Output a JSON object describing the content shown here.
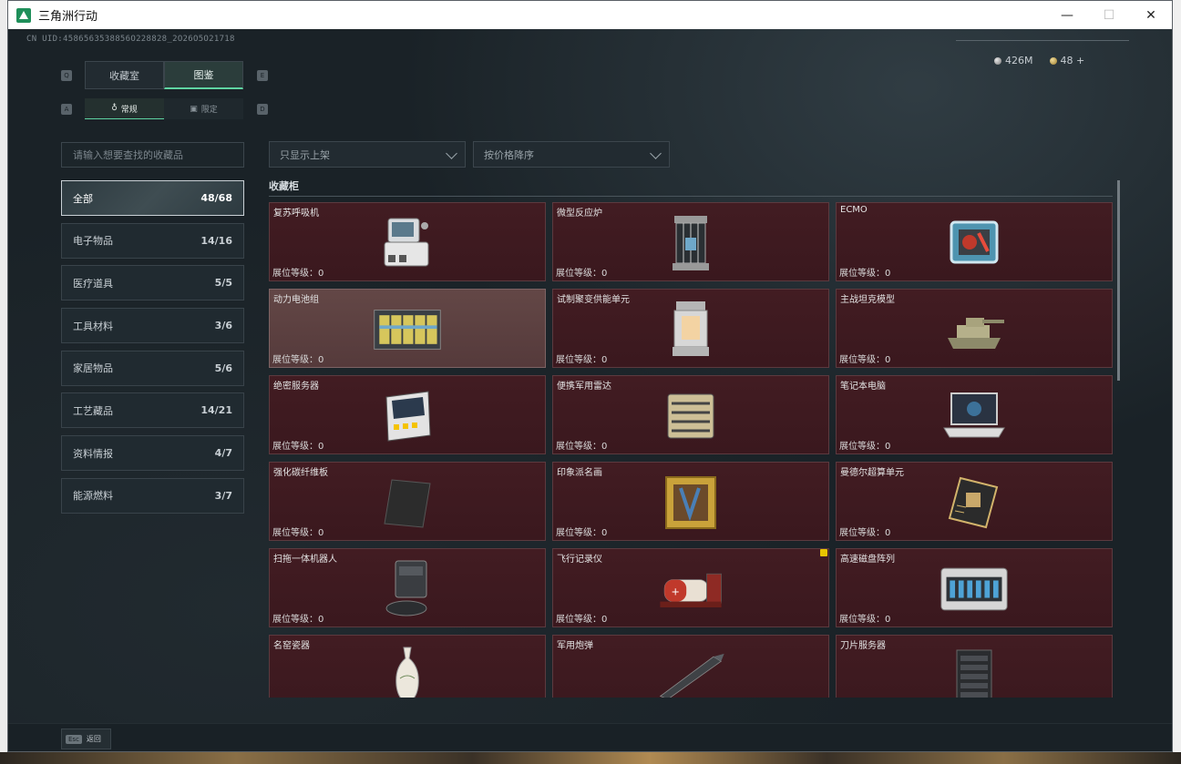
{
  "window": {
    "title": "三角洲行动",
    "minimize": "—",
    "maximize": "☐",
    "close": "✕"
  },
  "header": {
    "uid": "CN UID:4586563538856O228828_2O26O5O21718",
    "currency_silver": "426M",
    "currency_gold": "48 +"
  },
  "keys": {
    "q": "Q",
    "e": "E",
    "a": "A",
    "d": "D"
  },
  "tabs": [
    {
      "label": "收藏室",
      "active": false
    },
    {
      "label": "图鉴",
      "active": true
    }
  ],
  "subtabs": [
    {
      "label": "常规",
      "active": true
    },
    {
      "label": "限定",
      "active": false
    }
  ],
  "search": {
    "placeholder": "请输入想要查找的收藏品"
  },
  "filters": {
    "shelf": "只显示上架",
    "sort": "按价格降序"
  },
  "categories": [
    {
      "label": "全部",
      "count": "48/68",
      "active": true
    },
    {
      "label": "电子物品",
      "count": "14/16"
    },
    {
      "label": "医疗道具",
      "count": "5/5"
    },
    {
      "label": "工具材料",
      "count": "3/6"
    },
    {
      "label": "家居物品",
      "count": "5/6"
    },
    {
      "label": "工艺藏品",
      "count": "14/21"
    },
    {
      "label": "资料情报",
      "count": "4/7"
    },
    {
      "label": "能源燃料",
      "count": "3/7"
    }
  ],
  "section_title": "收藏柜",
  "level_label": "展位等级：0",
  "items": [
    {
      "name": "复苏呼吸机",
      "icon": "ventilator-icon"
    },
    {
      "name": "微型反应炉",
      "icon": "reactor-icon"
    },
    {
      "name": "ECMO",
      "icon": "ecmo-icon"
    },
    {
      "name": "动力电池组",
      "icon": "battery-pack-icon",
      "highlight": true
    },
    {
      "name": "试制聚变供能单元",
      "icon": "fusion-unit-icon"
    },
    {
      "name": "主战坦克模型",
      "icon": "tank-model-icon"
    },
    {
      "name": "绝密服务器",
      "icon": "secret-server-icon"
    },
    {
      "name": "便携军用雷达",
      "icon": "radar-icon"
    },
    {
      "name": "笔记本电脑",
      "icon": "laptop-icon"
    },
    {
      "name": "强化碳纤维板",
      "icon": "carbon-plate-icon"
    },
    {
      "name": "印象派名画",
      "icon": "painting-icon"
    },
    {
      "name": "曼德尔超算单元",
      "icon": "supercomputer-icon"
    },
    {
      "name": "扫拖一体机器人",
      "icon": "robot-vacuum-icon"
    },
    {
      "name": "飞行记录仪",
      "icon": "flight-recorder-icon",
      "badge": true
    },
    {
      "name": "高速磁盘阵列",
      "icon": "disk-array-icon"
    },
    {
      "name": "名窑瓷器",
      "icon": "porcelain-icon"
    },
    {
      "name": "军用炮弹",
      "icon": "shell-icon"
    },
    {
      "name": "刀片服务器",
      "icon": "blade-server-icon"
    }
  ],
  "footer": {
    "esc_key": "Esc",
    "esc_label": "返回"
  },
  "colors": {
    "card_bg": "#3d1a20",
    "card_highlight": "#5a3e3f",
    "accent": "#5fd4a2",
    "badge": "#e8c400"
  }
}
